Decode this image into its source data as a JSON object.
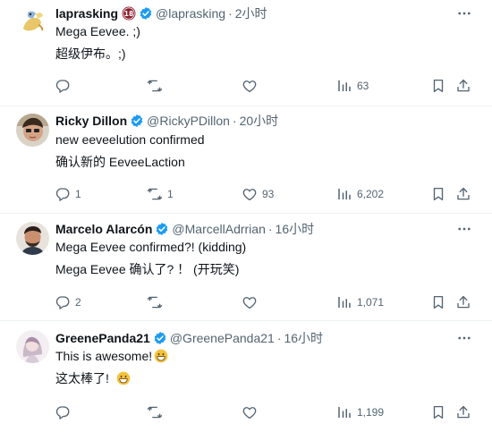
{
  "tweets": [
    {
      "display_name": "laprasking",
      "handle": "@laprasking",
      "dot": "·",
      "time": "2小时",
      "line1": "Mega Eevee. ;)",
      "line2": "超级伊布。;)",
      "reply_count": "",
      "retweet_count": "",
      "like_count": "",
      "view_count": "63",
      "badge_text": "18"
    },
    {
      "display_name": "Ricky Dillon",
      "handle": "@RickyPDillon",
      "dot": "·",
      "time": "20小时",
      "line1": "new eeveelution confirmed",
      "line2": "确认新的 EeveeLaction",
      "reply_count": "1",
      "retweet_count": "1",
      "like_count": "93",
      "view_count": "6,202"
    },
    {
      "display_name": "Marcelo Alarcón",
      "handle": "@MarcellAdrrian",
      "dot": "·",
      "time": "16小时",
      "line1": "Mega Eevee confirmed?! (kidding)",
      "line2": "Mega Eevee 确认了? ！  (开玩笑)",
      "reply_count": "2",
      "retweet_count": "",
      "like_count": "",
      "view_count": "1,071"
    },
    {
      "display_name": "GreenePanda21",
      "handle": "@GreenePanda21",
      "dot": "·",
      "time": "16小时",
      "line1": "This is awesome!",
      "line2": "这太棒了!",
      "reply_count": "",
      "retweet_count": "",
      "like_count": "",
      "view_count": "1,199"
    }
  ],
  "colors": {
    "text": "#0f1419",
    "muted": "#536471",
    "verified": "#1d9bf0",
    "divider": "#eff3f4",
    "age_badge": "#8b1c2b"
  },
  "icons": [
    "reply-icon",
    "retweet-icon",
    "like-icon",
    "views-icon",
    "bookmark-icon",
    "share-icon",
    "more-icon",
    "verified-badge-icon",
    "grinning-emoji-icon"
  ]
}
